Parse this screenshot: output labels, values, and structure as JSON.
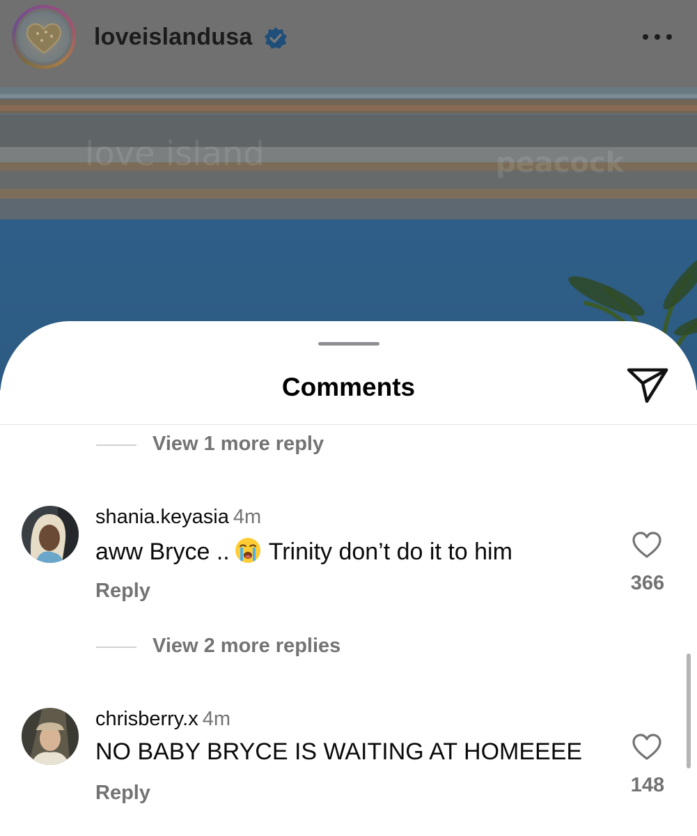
{
  "post_header": {
    "username": "loveislandusa",
    "avatar_icon": "heart-logo-icon",
    "verified_icon": "verified-badge-icon",
    "more_icon": "more-options-icon"
  },
  "sheet": {
    "title": "Comments",
    "share_icon": "paper-plane-icon"
  },
  "thread": {
    "view_more_top": "View 1 more reply",
    "comments": [
      {
        "username": "shania.keyasia",
        "time": "4m",
        "text_before_emoji": "aww Bryce ..",
        "emoji": "loudly-crying-face-emoji",
        "text_after_emoji": "Trinity don’t do it to him",
        "reply_label": "Reply",
        "likes": "366"
      },
      {
        "username": "chrisberry.x",
        "time": "4m",
        "text": "NO BABY BRYCE IS WAITING AT HOMEEEE",
        "reply_label": "Reply",
        "likes": "148"
      }
    ],
    "view_more_middle": "View 2 more replies"
  },
  "colors": {
    "text_primary": "#0a0a0a",
    "text_secondary": "#737373",
    "verified_blue": "#1877f2"
  }
}
